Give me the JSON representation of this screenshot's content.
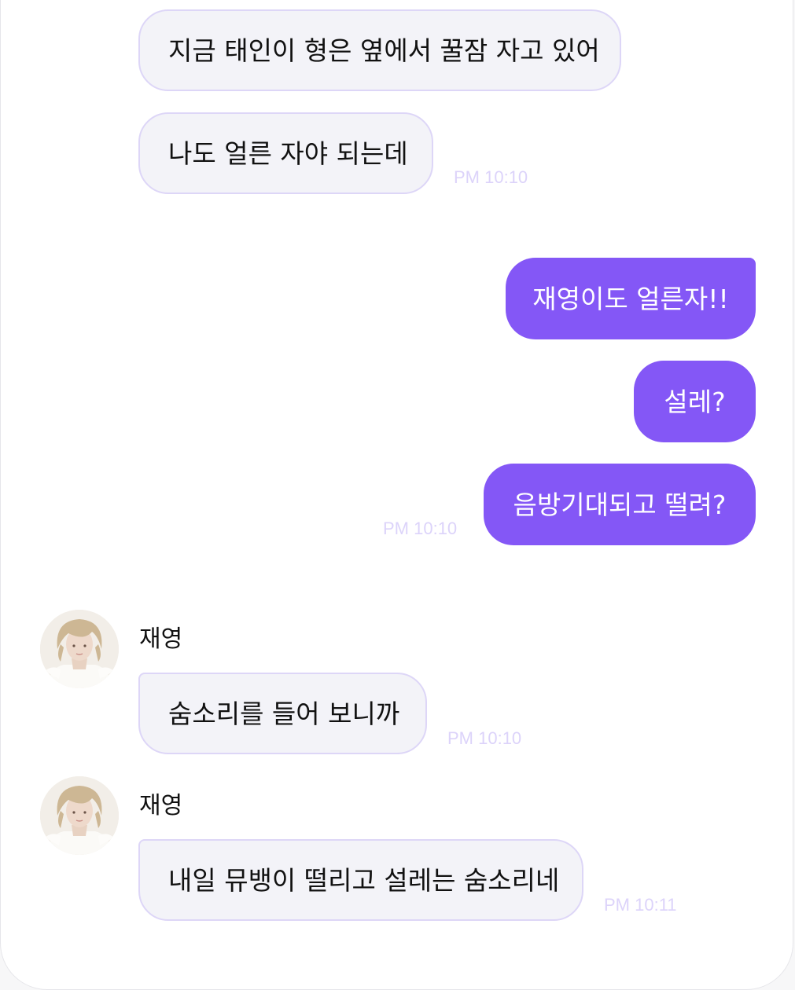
{
  "colors": {
    "accent": "#8457f6",
    "incoming_bubble": "#f3f3f8",
    "incoming_border": "#ddd6f7",
    "timestamp": "#dcd3fa"
  },
  "messages": [
    {
      "direction": "incoming",
      "text": "지금 태인이 형은 옆에서 꿀잠 자고 있어"
    },
    {
      "direction": "incoming",
      "text": "나도 얼른 자야 되는데",
      "time": "PM 10:10"
    },
    {
      "direction": "outgoing",
      "text": "재영이도 얼른자!!"
    },
    {
      "direction": "outgoing",
      "text": "설레?"
    },
    {
      "direction": "outgoing",
      "text": "음방기대되고 떨려?",
      "time": "PM 10:10"
    },
    {
      "direction": "incoming",
      "sender": "재영",
      "avatar": "profile-photo",
      "text": "숨소리를 들어 보니까",
      "time": "PM 10:10"
    },
    {
      "direction": "incoming",
      "sender": "재영",
      "avatar": "profile-photo",
      "text": "내일 뮤뱅이 떨리고 설레는 숨소리네",
      "time": "PM 10:11"
    }
  ]
}
